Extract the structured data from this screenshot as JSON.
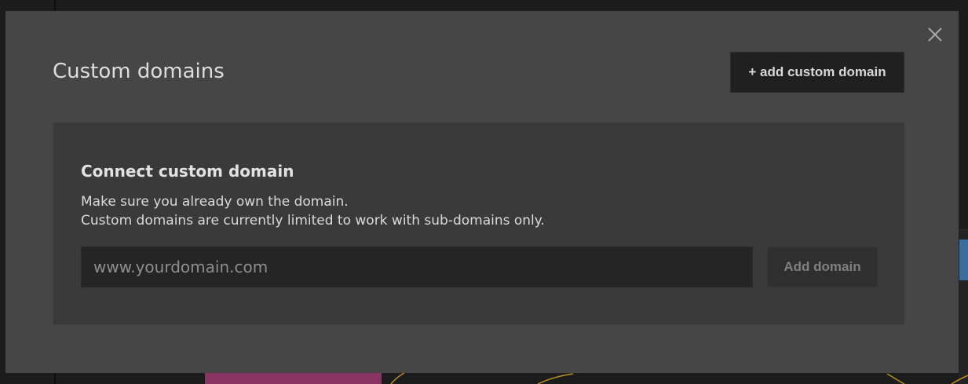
{
  "modal": {
    "title": "Custom domains",
    "add_button_label": "+ add custom domain",
    "close_icon": "close-icon"
  },
  "connect_panel": {
    "heading": "Connect custom domain",
    "description_line1": "Make sure you already own the domain.",
    "description_line2": "Custom domains are currently limited to work with sub-domains only.",
    "input_value": "",
    "input_placeholder": "www.yourdomain.com",
    "submit_label": "Add domain"
  },
  "colors": {
    "modal_bg": "#464646",
    "panel_bg": "#3a3a3a",
    "input_bg": "#252525",
    "primary_button_bg": "#202020",
    "disabled_button_bg": "#2f2f2f"
  }
}
